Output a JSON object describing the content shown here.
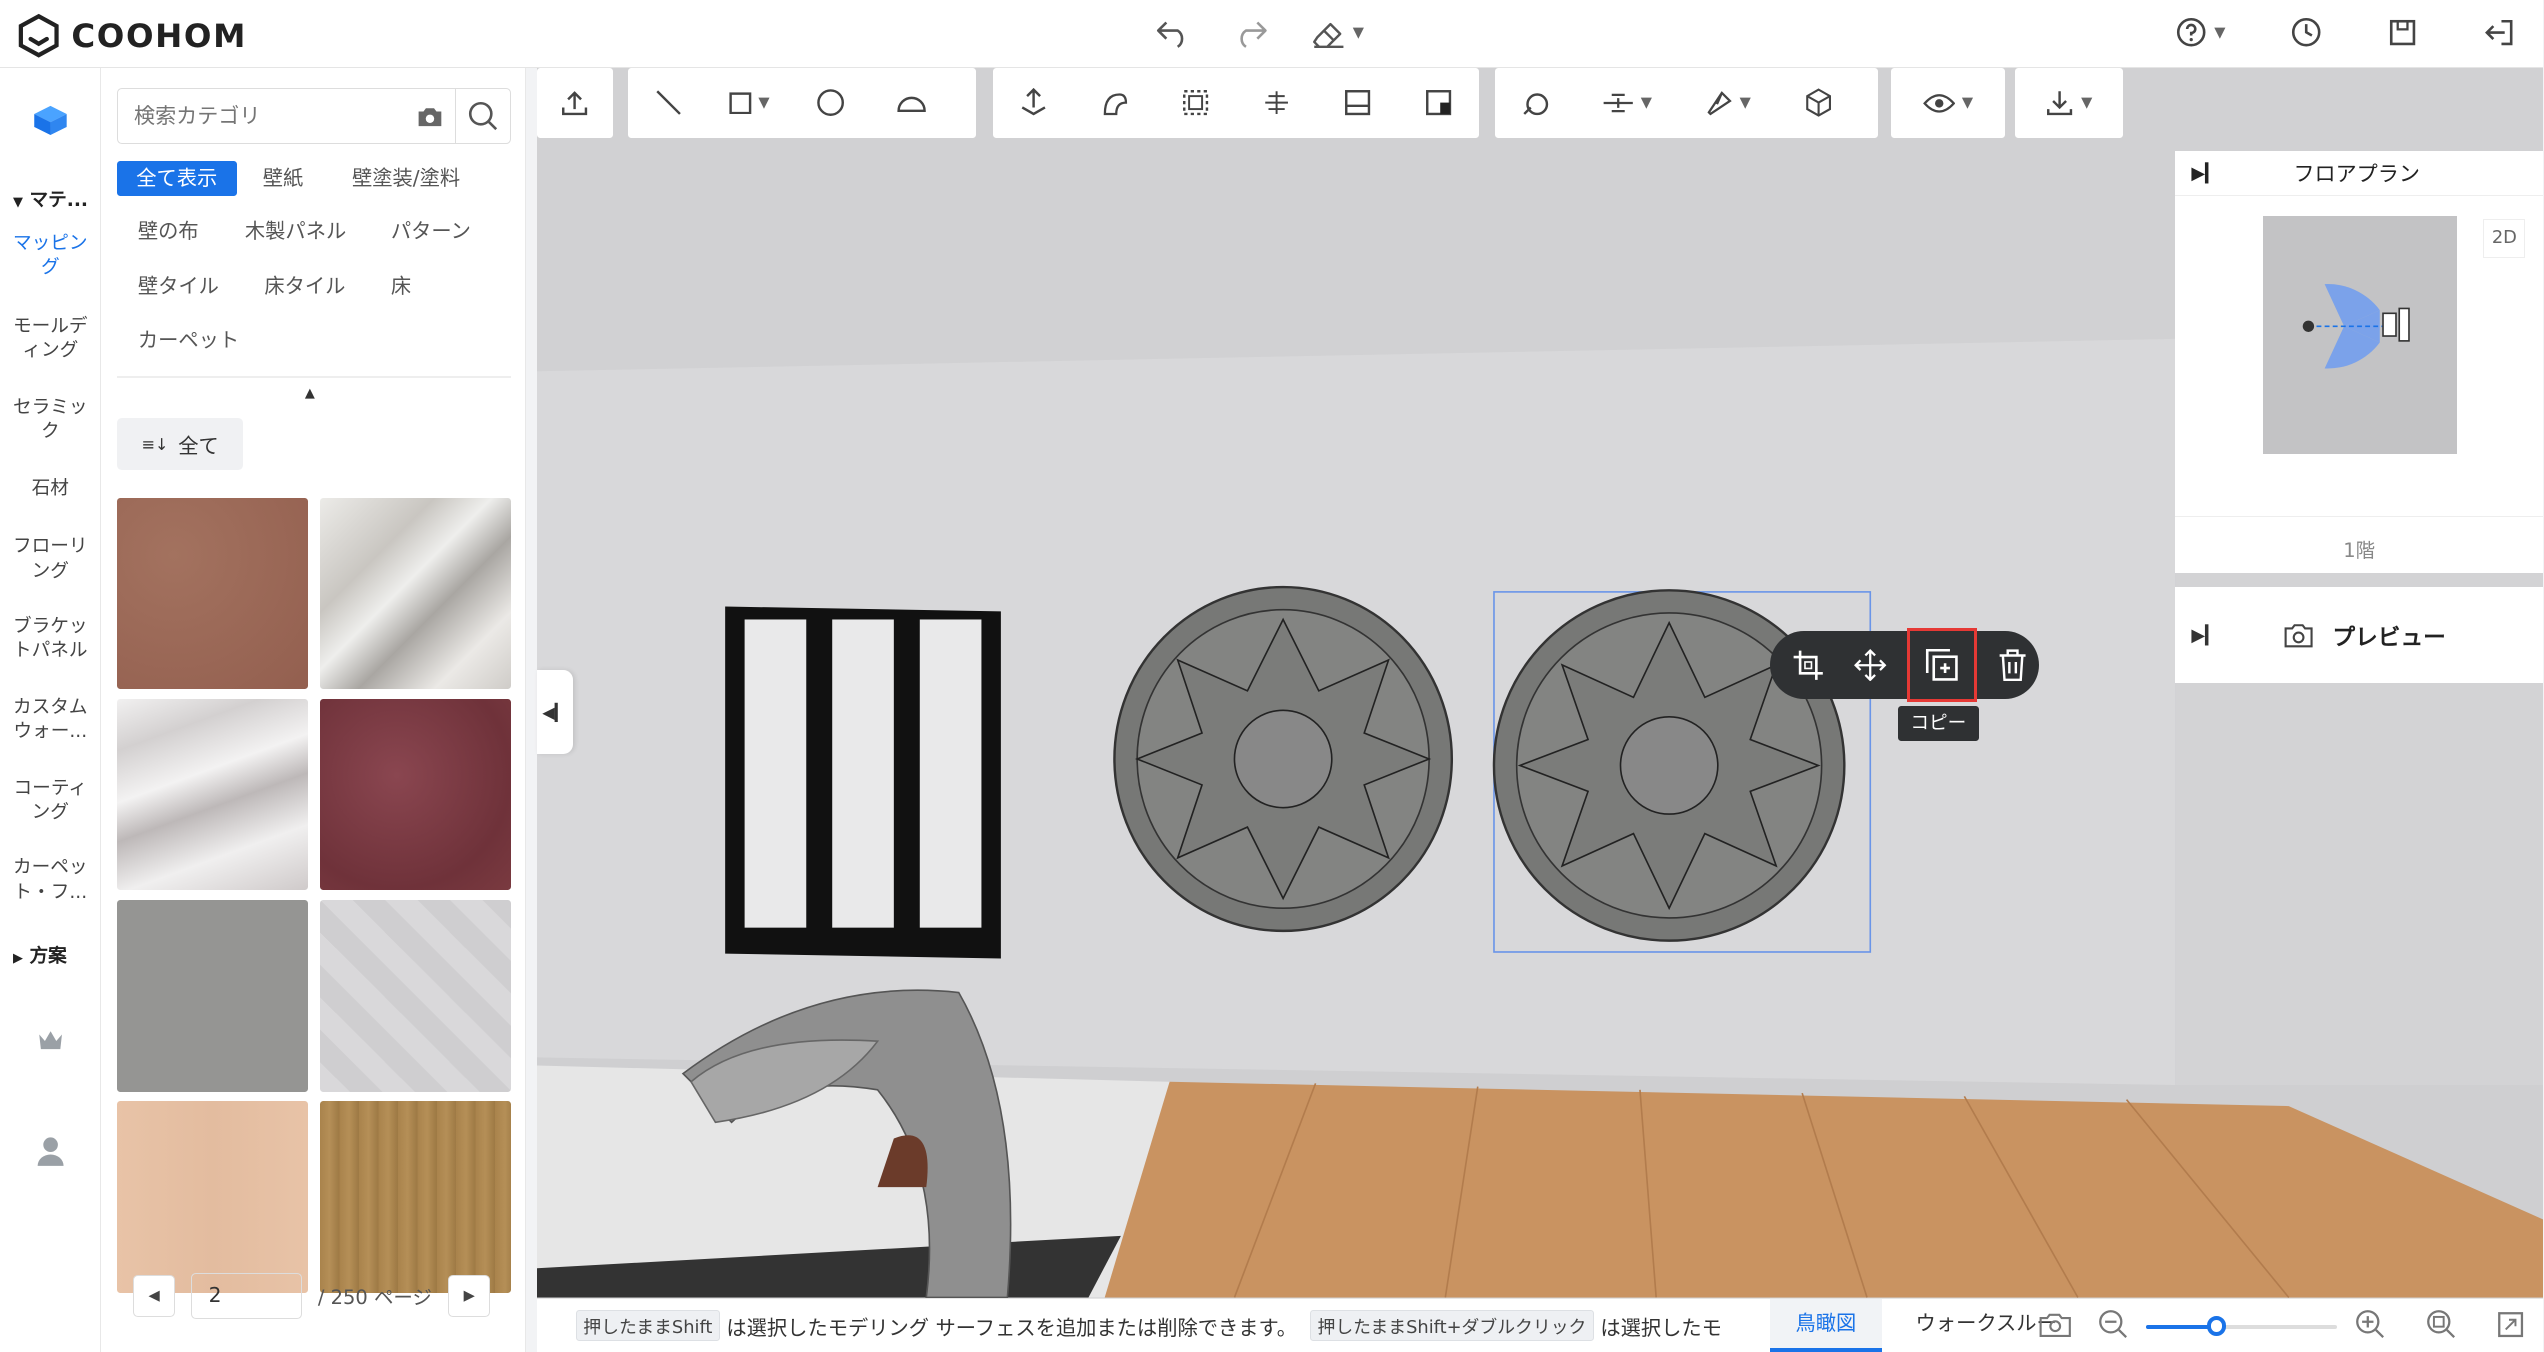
{
  "app": {
    "logo_text": "COOHOM"
  },
  "topbar": {
    "icons": [
      "undo-icon",
      "redo-icon",
      "eraser-icon",
      "help-icon",
      "history-icon",
      "save-icon",
      "exit-icon"
    ]
  },
  "leftnav": {
    "section_material": "マテ...",
    "section_plan": "方案",
    "items": [
      {
        "label": "マッピング",
        "active": true
      },
      {
        "label": "モールディング",
        "active": false
      },
      {
        "label": "セラミック",
        "active": false
      },
      {
        "label": "石材",
        "active": false
      },
      {
        "label": "フローリング",
        "active": false
      },
      {
        "label": "ブラケットパネル",
        "active": false
      },
      {
        "label": "カスタムウォー...",
        "active": false
      },
      {
        "label": "コーティング",
        "active": false
      },
      {
        "label": "カーペット・フ...",
        "active": false
      }
    ]
  },
  "catalog": {
    "search_placeholder": "検索カテゴリ",
    "categories": [
      "全て表示",
      "壁紙",
      "壁塗装/塗料",
      "壁の布",
      "木製パネル",
      "パターン",
      "壁タイル",
      "床タイル",
      "床",
      "カーペット"
    ],
    "active_category": "全て表示",
    "filter_label": "全て",
    "textures": [
      {
        "name": "terracotta-plaster",
        "color": "#9a6a5a"
      },
      {
        "name": "white-grey-marble",
        "color": "#d9d6d2"
      },
      {
        "name": "carrara-marble",
        "color": "#e6e4e4"
      },
      {
        "name": "red-granite",
        "color": "#7a3a40"
      },
      {
        "name": "grey-concrete",
        "color": "#959593"
      },
      {
        "name": "white-pattern",
        "color": "#d7d6d8"
      },
      {
        "name": "peach-wood",
        "color": "#e6c0a4"
      },
      {
        "name": "oak-wood",
        "color": "#a9834c"
      }
    ],
    "pager": {
      "page": "2",
      "total_label": "/ 250 ページ"
    }
  },
  "floating_toolbar": {
    "tooltip": "コピー"
  },
  "right_panel": {
    "floorplan_title": "フロアプラン",
    "mode_badge": "2D",
    "floor_label": "1階",
    "preview_label": "プレビュー"
  },
  "statusbar": {
    "key1": "押したままShift",
    "text1": "は選択したモデリング サーフェスを追加または削除できます。",
    "key2": "押したままShift+ダブルクリック",
    "text2": "は選択したモ",
    "tabs": [
      "鳥瞰図",
      "ウォークスルー"
    ],
    "active_tab": "鳥瞰図",
    "zoom_fraction": 0.37
  },
  "colors": {
    "accent": "#1a73e8",
    "highlight": "#e53935",
    "viewport_wall": "#d6d6d8",
    "floor_wood": "#c99361"
  }
}
